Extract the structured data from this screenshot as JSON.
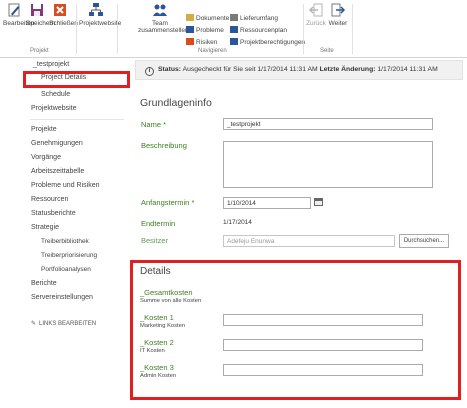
{
  "ribbon": {
    "project_group": {
      "label": "Projekt",
      "buttons": [
        {
          "label": "Bearbeiten"
        },
        {
          "label": "Speichern"
        },
        {
          "label": "Schließen"
        }
      ]
    },
    "website_button": "Projektwebsite",
    "navigate_group": {
      "label": "Navigieren",
      "team_button": "Team\nzusammenstellen",
      "links": [
        "Dokumente",
        "Probleme",
        "Risiken",
        "Lieferumfang",
        "Ressourcenplan",
        "Projektberechtigungen"
      ]
    },
    "page_group": {
      "label": "Seite",
      "back": "Zurück",
      "next": "Weiter"
    }
  },
  "sidebar": {
    "project_name": "_testprojekt",
    "project_details": "Project Details",
    "schedule": "Schedule",
    "project_website": "Projektwebsite",
    "items": [
      "Projekte",
      "Genehmigungen",
      "Vorgänge",
      "Arbeitszeittabelle",
      "Probleme und Risiken",
      "Ressourcen",
      "Statusberichte",
      "Strategie"
    ],
    "strategy_sub": [
      "Treiberbibliothek",
      "Treiberpriorisierung",
      "Portfolioanalysen"
    ],
    "bottom_items": [
      "Berichte",
      "Servereinstellungen"
    ],
    "edit_links": "LINKS BEARBEITEN"
  },
  "status_bar": {
    "status_label": "Status:",
    "status_text": "Ausgecheckt für Sie seit 1/17/2014 11:31 AM",
    "last_change_label": "Letzte Änderung:",
    "last_change_value": "1/17/2014 11:31 AM"
  },
  "basic_info": {
    "title": "Grundlageninfo",
    "name_label": "Name *",
    "name_value": "_testprojekt",
    "description_label": "Beschreibung",
    "start_label": "Anfangstermin *",
    "start_value": "1/10/2014",
    "end_label": "Endtermin",
    "end_value": "1/17/2014",
    "owner_label": "Besitzer",
    "owner_value": "Adefeju Enunwa",
    "browse_button": "Durchsuchen..."
  },
  "details": {
    "title": "Details",
    "fields": [
      {
        "label": "_Gesamtkosten",
        "desc": "Summe von alle Kosten"
      },
      {
        "label": "_Kosten 1",
        "desc": "Marketing Kosten"
      },
      {
        "label": "_Kosten 2",
        "desc": "IT Kosten"
      },
      {
        "label": "_Kosten 3",
        "desc": "Admin Kosten"
      }
    ]
  },
  "colors": {
    "highlight_border": "#e02020",
    "label_green": "#3a7f22",
    "save_purple": "#80397b",
    "close_orange": "#d84c20",
    "icon_blue": "#2b579a"
  }
}
